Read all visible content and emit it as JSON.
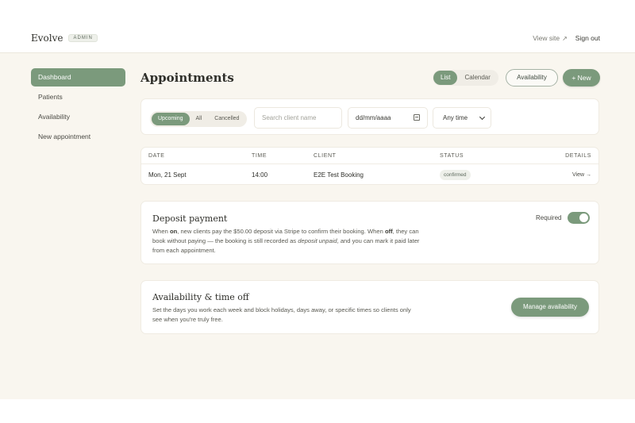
{
  "header": {
    "brand": "Evolve",
    "badge": "ADMIN",
    "view_site": "View site",
    "view_site_arrow": "↗",
    "sign_out": "Sign out"
  },
  "sidebar": {
    "items": [
      {
        "label": "Dashboard",
        "active": true
      },
      {
        "label": "Patients",
        "active": false
      },
      {
        "label": "Availability",
        "active": false
      },
      {
        "label": "New appointment",
        "active": false
      }
    ]
  },
  "main": {
    "title": "Appointments",
    "view_toggle": [
      "List",
      "Calendar"
    ],
    "availability_button": "Availability",
    "new_button": "+ New"
  },
  "filters": {
    "tabs": [
      "Upcoming",
      "All",
      "Cancelled"
    ],
    "search_placeholder": "Search client name",
    "date_value": "dd/mm/aaaa",
    "time_value": "Any time"
  },
  "table": {
    "headers": [
      "DATE",
      "TIME",
      "CLIENT",
      "STATUS",
      "DETAILS"
    ],
    "rows": [
      {
        "date": "Mon, 21 Sept",
        "time": "14:00",
        "client": "E2E Test Booking",
        "status": "confirmed",
        "details": "View →"
      }
    ]
  },
  "deposit": {
    "title": "Deposit payment",
    "text_1": "When ",
    "text_on": "on",
    "text_2": ", new clients pay the $50.00 deposit via Stripe to confirm their booking. When ",
    "text_off": "off",
    "text_3": ", they can book without paying — the booking is still recorded as ",
    "text_em": "deposit unpaid",
    "text_4": ", and you can mark it paid later from each appointment.",
    "required_label": "Required",
    "required_on": true
  },
  "availability": {
    "title": "Availability & time off",
    "text": "Set the days you work each week and block holidays, days away, or specific times so clients only see when you're truly free.",
    "button": "Manage availability"
  },
  "colors": {
    "accent": "#7b9a7c",
    "background": "#f9f6ef"
  }
}
